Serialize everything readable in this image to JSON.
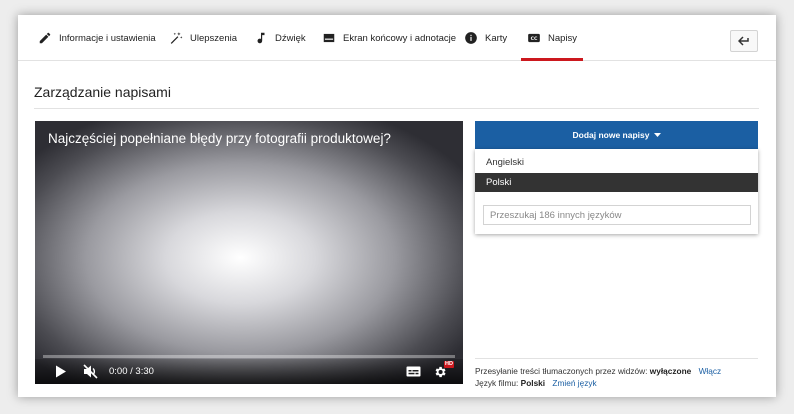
{
  "tabs": [
    {
      "label": "Informacje i ustawienia",
      "icon": "pencil-icon"
    },
    {
      "label": "Ulepszenia",
      "icon": "magic-wand-icon"
    },
    {
      "label": "Dźwięk",
      "icon": "music-note-icon"
    },
    {
      "label": "Ekran końcowy i adnotacje",
      "icon": "end-screen-icon"
    },
    {
      "label": "Karty",
      "icon": "info-icon"
    },
    {
      "label": "Napisy",
      "icon": "closed-captions-icon",
      "active": true
    }
  ],
  "back_button": {
    "icon": "back-arrow-icon"
  },
  "page_title": "Zarządzanie napisami",
  "player": {
    "video_title": "Najczęściej popełniane błędy przy fotografii produktowej?",
    "time": "0:00 / 3:30",
    "hd_badge": "HD",
    "icons": [
      "play-icon",
      "mute-icon",
      "subtitles-icon",
      "settings-icon"
    ]
  },
  "add_subtitles": {
    "label": "Dodaj nowe napisy",
    "icon": "caret-down-icon",
    "options": [
      "Angielski",
      "Polski"
    ],
    "selected": "Polski",
    "search_placeholder": "Przeszukaj 186 innych języków"
  },
  "community": {
    "prefix": "Przesyłanie treści tłumaczonych przez widzów:",
    "status": "wyłączone",
    "link": "Włącz"
  },
  "video_language": {
    "prefix": "Język filmu:",
    "value": "Polski",
    "link": "Zmień język"
  },
  "colors": {
    "accent_red": "#cc181e",
    "primary_blue": "#1b5fa3",
    "selected_option": "#333333"
  }
}
